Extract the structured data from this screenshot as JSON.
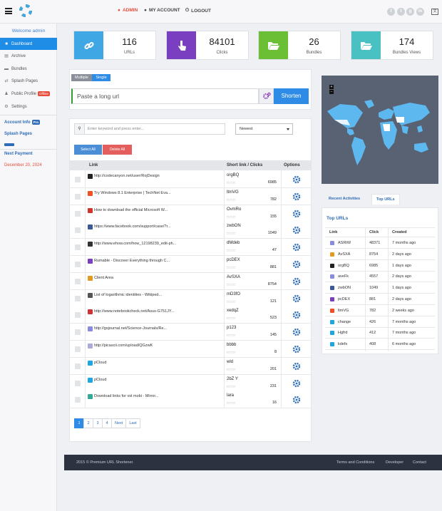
{
  "nav": {
    "admin": "ADMIN",
    "my_account": "MY ACCOUNT",
    "logout": "LOGOUT"
  },
  "sidebar": {
    "welcome": "Welcome admin",
    "items": [
      {
        "label": "Dashboard",
        "icon": "dashboard-icon"
      },
      {
        "label": "Archive",
        "icon": "archive-icon"
      },
      {
        "label": "Bundles",
        "icon": "bundles-icon"
      },
      {
        "label": "Splash Pages",
        "icon": "splash-icon"
      },
      {
        "label": "Public Profile",
        "icon": "profile-icon"
      },
      {
        "label": "Settings",
        "icon": "settings-icon"
      }
    ],
    "offline_badge": "Offline",
    "account_info": "Account Info",
    "pro_badge": "Pro",
    "splash_pages": "Splash Pages",
    "next_payment": "Next Payment",
    "next_payment_date": "December 20, 2024"
  },
  "stats": [
    {
      "value": "116",
      "label": "URLs",
      "color": "#40a7e5",
      "icon": "link-icon"
    },
    {
      "value": "84101",
      "label": "Clicks",
      "color": "#7a3fc1",
      "icon": "pointer-icon"
    },
    {
      "value": "26",
      "label": "Bundles",
      "color": "#6bbf34",
      "icon": "folder-open-icon"
    },
    {
      "value": "174",
      "label": "Bundles Views",
      "color": "#49c1c3",
      "icon": "folder-icon"
    }
  ],
  "shorten": {
    "multiple": "Multiple",
    "single": "Single",
    "placeholder": "Paste a long url",
    "button": "Shorten"
  },
  "list": {
    "search_placeholder": "Enter keyword and press enter...",
    "sort": "Newest",
    "select_all": "Select All",
    "delete_all": "Delete All",
    "col_link": "Link",
    "col_short": "Short link / Clicks",
    "col_options": "Options",
    "rows": [
      {
        "link": "http://codecanyon.net/user/RojDesign",
        "short": "orgBQ",
        "clicks": "6985",
        "fav": "#222"
      },
      {
        "link": "Try Windows 8.1 Enterprise | TechNet Eva...",
        "short": "ltmVG",
        "clicks": "782",
        "fav": "#f25022"
      },
      {
        "link": "How to download the official Microsoft W...",
        "short": "OvmRo",
        "clicks": "155",
        "fav": "#d0342c"
      },
      {
        "link": "https://www.facebook.com/support/case/?r...",
        "short": "zwbON",
        "clicks": "1049",
        "fav": "#3b5998"
      },
      {
        "link": "http://www.ehow.com/how_12198239_edit-ph...",
        "short": "dMdeb",
        "clicks": "47",
        "fav": "#333"
      },
      {
        "link": "Rumable - Discover Everything through C...",
        "short": "pcDEX",
        "clicks": "881",
        "fav": "#7a3fc1"
      },
      {
        "link": "Client Area",
        "short": "AvSXA",
        "clicks": "8754",
        "fav": "#e39b1f"
      },
      {
        "link": "List of logarithmic identities - Wikiped...",
        "short": "mD3fO",
        "clicks": "121",
        "fav": "#555"
      },
      {
        "link": "http://www.notebookcheck.net/Asus-G751JY...",
        "short": "xedqZ",
        "clicks": "523",
        "fav": "#c33"
      },
      {
        "link": "http://gsjournal.net/Science-Journals/Re...",
        "short": "p123",
        "clicks": "145",
        "fav": "#8a8adf"
      },
      {
        "link": "http://picascii.com/upload/QGzwK",
        "short": "bbbb",
        "clicks": "8",
        "fav": "#aad"
      },
      {
        "link": "pCloud",
        "short": "wld",
        "clicks": "201",
        "fav": "#20a5e3"
      },
      {
        "link": "pCloud",
        "short": "2bZ Y",
        "clicks": "231",
        "fav": "#20a5e3"
      },
      {
        "link": "Download links for vst mobi - Mirror...",
        "short": "lara",
        "clicks": "16",
        "fav": "#3a9"
      }
    ],
    "pages": [
      "1",
      "2",
      "3",
      "4",
      "Next",
      "Last"
    ]
  },
  "right": {
    "tab_recent": "Recent Activities",
    "tab_top": "Top URLs",
    "top_title": "Top URLs",
    "col_link": "Link",
    "col_click": "Click",
    "col_created": "Created",
    "rows": [
      {
        "link": "ASRtW",
        "click": "48371",
        "created": "7 months ago",
        "fav": "#8a8adf"
      },
      {
        "link": "AvSXA",
        "click": "8754",
        "created": "2 days ago",
        "fav": "#e39b1f"
      },
      {
        "link": "orgBQ",
        "click": "6985",
        "created": "1 days ago",
        "fav": "#222"
      },
      {
        "link": "aveFk",
        "click": "4557",
        "created": "2 days ago",
        "fav": "#8a8adf"
      },
      {
        "link": "zwbON",
        "click": "1049",
        "created": "1 days ago",
        "fav": "#3b5998"
      },
      {
        "link": "pcDEX",
        "click": "881",
        "created": "2 days ago",
        "fav": "#7a3fc1"
      },
      {
        "link": "ltmVG",
        "click": "782",
        "created": "2 weeks ago",
        "fav": "#f25022"
      },
      {
        "link": "change",
        "click": "426",
        "created": "7 months ago",
        "fav": "#20a5e3"
      },
      {
        "link": "Hgfrd",
        "click": "412",
        "created": "7 months ago",
        "fav": "#20a5e3"
      },
      {
        "link": "kdefs",
        "click": "408",
        "created": "6 months ago",
        "fav": "#20a5e3"
      }
    ]
  },
  "footer": {
    "copyright": "2015 © Premium URL Shortener.",
    "terms": "Terms and Conditions",
    "developer": "Developer",
    "contact": "Contact"
  },
  "colors": {
    "accent": "#2e8be6",
    "active_nav": "#e74c3c",
    "map_land": "#5db8f0",
    "map_bg": "#596273"
  }
}
